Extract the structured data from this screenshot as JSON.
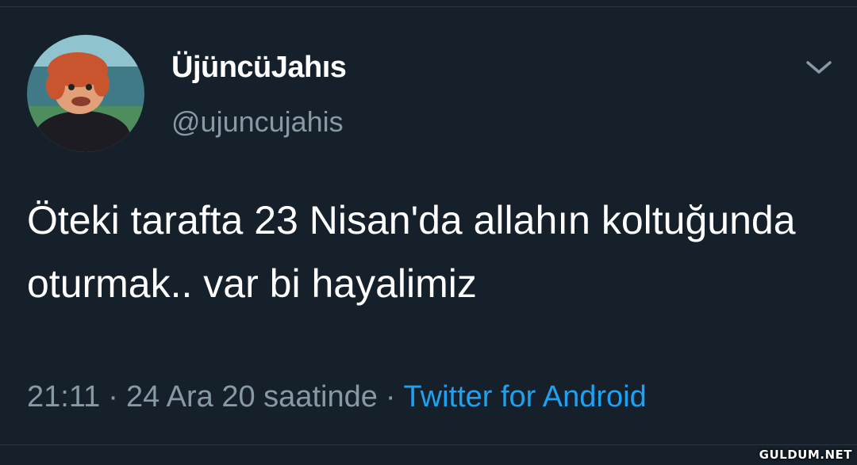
{
  "user": {
    "display_name": "ÜjüncüJahıs",
    "handle": "@ujuncujahis",
    "avatar_icon": "puppet-avatar"
  },
  "tweet": {
    "text": "Öteki tarafta 23 Nisan'da allahın koltuğunda oturmak.. var bi hayalimiz",
    "time": "21:11",
    "date": "24 Ara 20 saatinde",
    "separator": "·",
    "source": "Twitter for Android"
  },
  "menu": {
    "icon": "chevron-down-icon"
  },
  "watermark": "GULDUM.NET",
  "colors": {
    "background": "#15202b",
    "secondary_text": "#8899a6",
    "accent": "#1da1f2"
  }
}
